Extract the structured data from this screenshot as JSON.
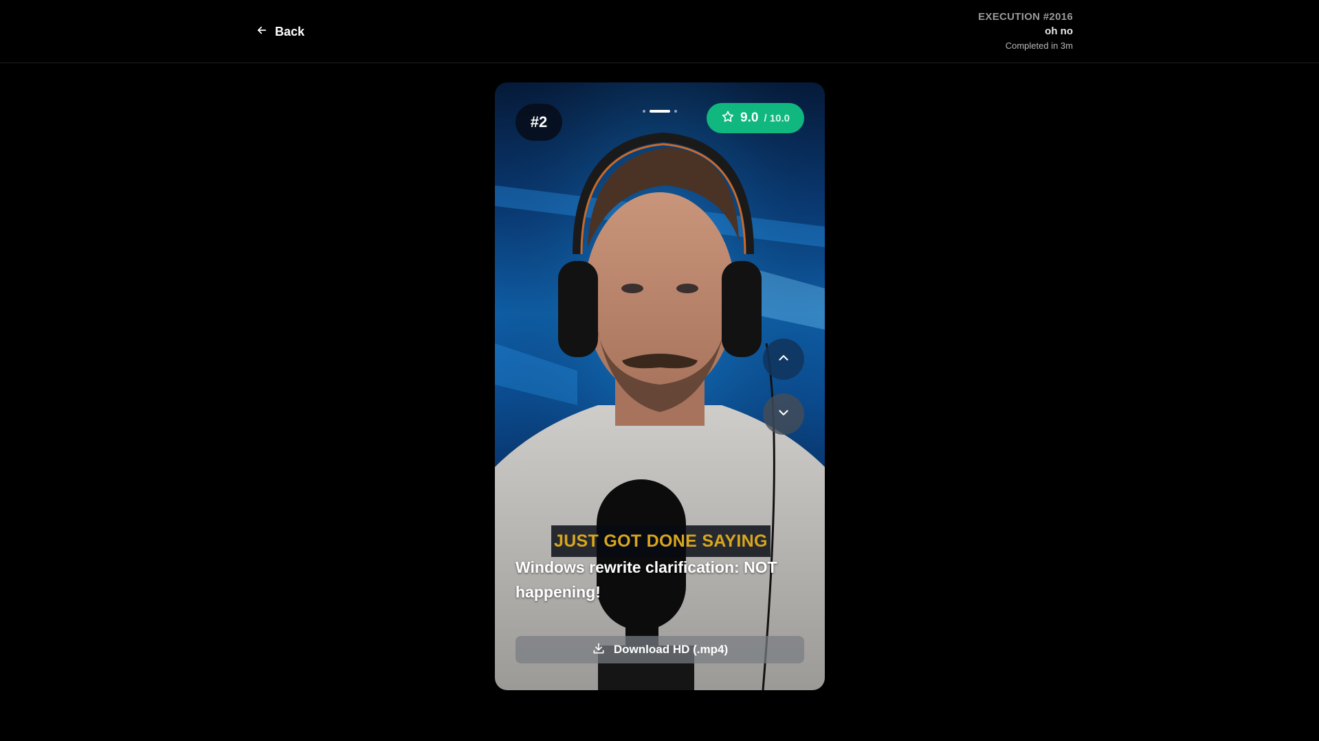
{
  "header": {
    "back_label": "Back",
    "execution_title": "EXECUTION #2016",
    "execution_name": "oh no",
    "execution_status": "Completed in 3m"
  },
  "clip": {
    "rank": "#2",
    "score": "9.0",
    "score_max": "/ 10.0",
    "caption": "JUST GOT DONE SAYING",
    "title": "Windows rewrite clarification: NOT happening!",
    "download_label": "Download HD (.mp4)",
    "pager": {
      "count": 3,
      "active_index": 1
    }
  },
  "colors": {
    "score_pill": "#10b77f",
    "caption_text": "#d9a61e",
    "background": "#000000"
  },
  "icons": {
    "back": "arrow-left-icon",
    "score": "star-icon",
    "prev": "chevron-up-icon",
    "next": "chevron-down-icon",
    "download": "download-icon"
  }
}
